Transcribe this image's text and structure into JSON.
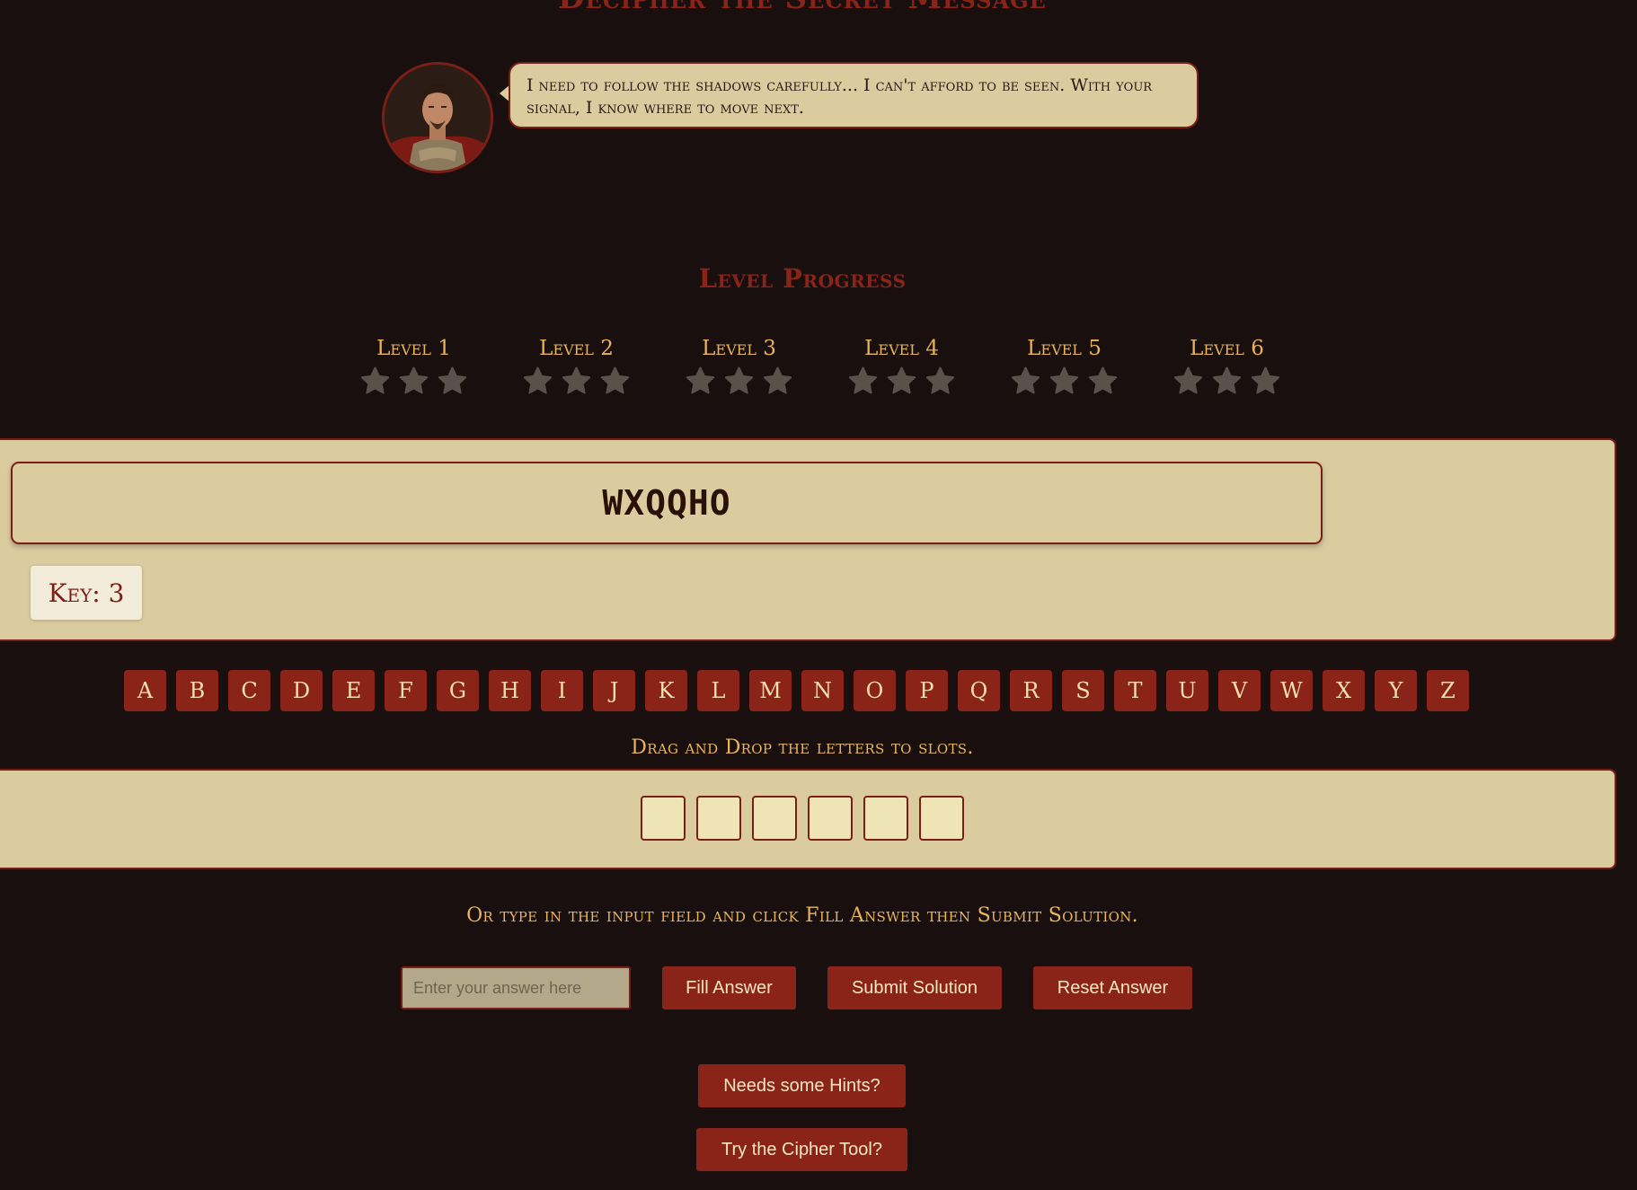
{
  "page": {
    "title": "Decipher the Secret Message"
  },
  "character": {
    "speech": "I need to follow the shadows carefully... I can't afford to be seen. With your signal, I know where to move next."
  },
  "progress": {
    "title": "Level Progress",
    "levels": [
      {
        "label": "Level 1",
        "stars_earned": 0,
        "stars_total": 3
      },
      {
        "label": "Level 2",
        "stars_earned": 0,
        "stars_total": 3
      },
      {
        "label": "Level 3",
        "stars_earned": 0,
        "stars_total": 3
      },
      {
        "label": "Level 4",
        "stars_earned": 0,
        "stars_total": 3
      },
      {
        "label": "Level 5",
        "stars_earned": 0,
        "stars_total": 3
      },
      {
        "label": "Level 6",
        "stars_earned": 0,
        "stars_total": 3
      }
    ]
  },
  "cipher": {
    "text": "WXQQHO",
    "key_label": "Key: 3"
  },
  "alphabet": [
    "A",
    "B",
    "C",
    "D",
    "E",
    "F",
    "G",
    "H",
    "I",
    "J",
    "K",
    "L",
    "M",
    "N",
    "O",
    "P",
    "Q",
    "R",
    "S",
    "T",
    "U",
    "V",
    "W",
    "X",
    "Y",
    "Z"
  ],
  "instructions": {
    "drag": "Drag and Drop the letters to slots.",
    "type": "Or type in the input field and click Fill Answer then Submit Solution."
  },
  "slots": {
    "count": 6
  },
  "answer": {
    "placeholder": "Enter your answer here",
    "value": ""
  },
  "buttons": {
    "fill": "Fill Answer",
    "submit": "Submit Solution",
    "reset": "Reset Answer",
    "hints": "Needs some Hints?",
    "cipher_tool": "Try the Cipher Tool?"
  },
  "colors": {
    "background": "#1a0f0f",
    "accent": "#8a2318",
    "parchment": "#dbcc9f",
    "gold_text": "#e8b55a",
    "star_empty": "#5a514b"
  }
}
